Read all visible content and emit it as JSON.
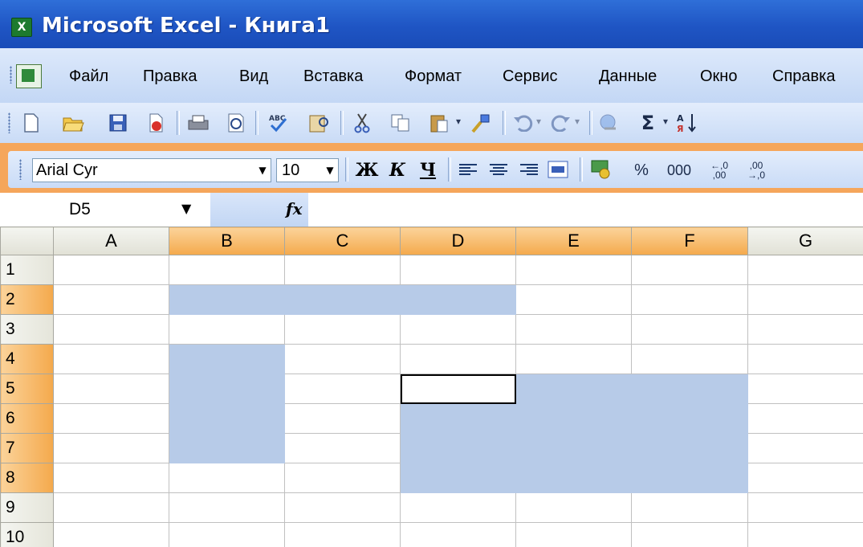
{
  "window": {
    "title": "Microsoft Excel - Книга1",
    "app_icon_label": "X"
  },
  "menu": {
    "items": [
      {
        "label": "Файл"
      },
      {
        "label": "Правка"
      },
      {
        "label": "Вид"
      },
      {
        "label": "Вставка"
      },
      {
        "label": "Формат"
      },
      {
        "label": "Сервис"
      },
      {
        "label": "Данные"
      },
      {
        "label": "Окно"
      },
      {
        "label": "Справка"
      }
    ]
  },
  "standard_toolbar": {
    "icons": [
      "new-document-icon",
      "open-folder-icon",
      "save-icon",
      "permission-icon",
      "print-icon",
      "print-preview-icon",
      "spelling-icon",
      "research-icon",
      "cut-icon",
      "copy-icon",
      "paste-icon",
      "format-painter-icon",
      "undo-icon",
      "redo-icon",
      "hyperlink-icon",
      "autosum-icon",
      "sort-ascending-icon"
    ],
    "autosum_label": "Σ"
  },
  "formatting_toolbar": {
    "font": "Arial Cyr",
    "size": "10",
    "bold_label": "Ж",
    "italic_label": "К",
    "underline_label": "Ч",
    "percent_label": "%",
    "thousands_label": "000",
    "increase_decimal_label": "←,0 ,00",
    "decrease_decimal_label": ",00 →,0"
  },
  "formula_bar": {
    "cell_ref": "D5",
    "fx_label": "fx",
    "formula": ""
  },
  "sheet": {
    "columns": [
      "A",
      "B",
      "C",
      "D",
      "E",
      "F",
      "G"
    ],
    "rows": [
      "1",
      "2",
      "3",
      "4",
      "5",
      "6",
      "7",
      "8",
      "9",
      "10"
    ],
    "active_cell": "D5",
    "selected_columns": [
      "B",
      "C",
      "D",
      "E",
      "F"
    ],
    "selected_rows": [
      "2",
      "4",
      "5",
      "6",
      "7",
      "8"
    ],
    "selection_ranges": [
      "B2:D2",
      "B4:B7",
      "D5:F8"
    ],
    "highlight_color": "#b7cbe8",
    "header_selected_color": "#f4a94c"
  }
}
